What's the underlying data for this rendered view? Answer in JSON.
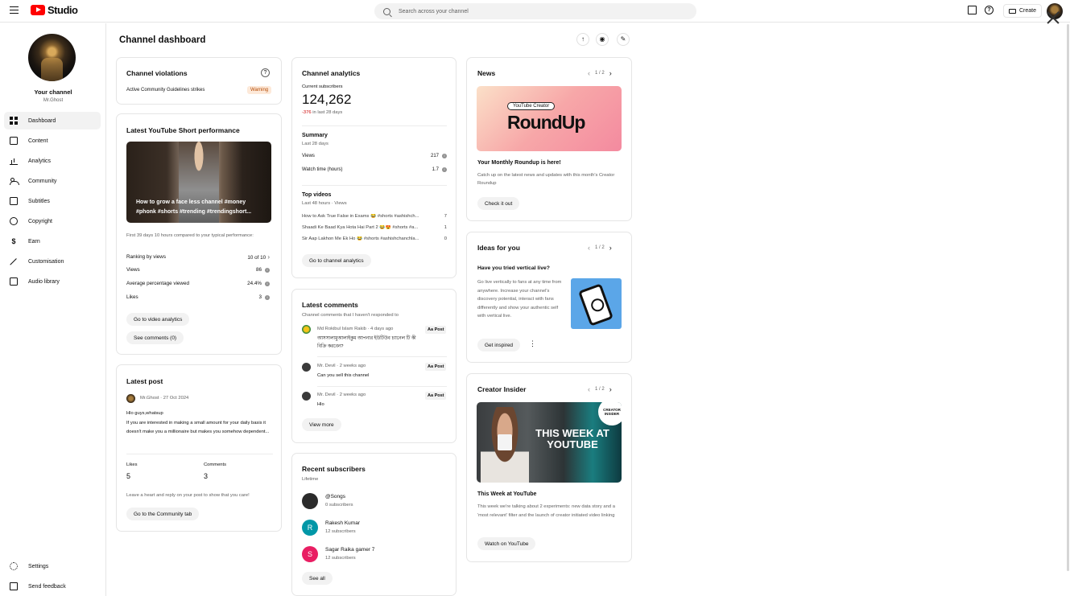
{
  "topbar": {
    "logo_text": "Studio",
    "search_placeholder": "Search across your channel",
    "create_label": "Create"
  },
  "sidebar": {
    "channel_label": "Your channel",
    "channel_name": "Mr.Ghost",
    "items": [
      {
        "label": "Dashboard",
        "icon": "dashboard-icon",
        "active": true
      },
      {
        "label": "Content",
        "icon": "content-icon"
      },
      {
        "label": "Analytics",
        "icon": "analytics-icon"
      },
      {
        "label": "Community",
        "icon": "community-icon"
      },
      {
        "label": "Subtitles",
        "icon": "subtitles-icon"
      },
      {
        "label": "Copyright",
        "icon": "copyright-icon"
      },
      {
        "label": "Earn",
        "icon": "earn-icon"
      },
      {
        "label": "Customisation",
        "icon": "customisation-icon"
      },
      {
        "label": "Audio library",
        "icon": "audio-library-icon"
      }
    ],
    "bottom_items": [
      {
        "label": "Settings",
        "icon": "settings-icon"
      },
      {
        "label": "Send feedback",
        "icon": "feedback-icon"
      }
    ]
  },
  "page": {
    "title": "Channel dashboard"
  },
  "violations": {
    "title": "Channel violations",
    "row_label": "Active Community Guidelines strikes",
    "badge": "Warning"
  },
  "short_perf": {
    "title": "Latest YouTube Short performance",
    "thumb_caption": "How to grow a face less channel #money #phonk #shorts #trending #trendingshort...",
    "period": "First 39 days 10 hours compared to your typical performance:",
    "rows": [
      {
        "label": "Ranking by views",
        "value": "10 of 10"
      },
      {
        "label": "Views",
        "value": "86"
      },
      {
        "label": "Average percentage viewed",
        "value": "24.4%"
      },
      {
        "label": "Likes",
        "value": "3"
      }
    ],
    "btn_analytics": "Go to video analytics",
    "btn_comments": "See comments (0)"
  },
  "latest_post": {
    "title": "Latest post",
    "author": "Mr.Ghost",
    "date": "27 Oct 2024",
    "text_line1": "Hlo guys,whatsup",
    "text_body": "If you are interested in making a small amount for your daily basis it doesn't make you a millionaire but makes you somehow dependent...",
    "likes_label": "Likes",
    "likes_value": "5",
    "comments_label": "Comments",
    "comments_value": "3",
    "hint": "Leave a heart and reply on your post to show that you care!",
    "btn": "Go to the Community tab"
  },
  "analytics": {
    "title": "Channel analytics",
    "subs_label": "Current subscribers",
    "subs_value": "124,262",
    "subs_change": "-376",
    "subs_change_suffix": "in last 28 days",
    "summary_title": "Summary",
    "summary_period": "Last 28 days",
    "views_label": "Views",
    "views_value": "217",
    "watch_label": "Watch time (hours)",
    "watch_value": "1.7",
    "top_title": "Top videos",
    "top_period": "Last 48 hours · Views",
    "top_videos": [
      {
        "title": "How to Ask True False in Exams 😂 #shorts #ashishch...",
        "views": "7"
      },
      {
        "title": "Shaadi Ke Baad Kya Hota Hai Part 2 😂😍 #shorts #a...",
        "views": "1"
      },
      {
        "title": "Sir Aap Lakhon Me Ek Ho 😂 #shorts #ashishchanchla...",
        "views": "0"
      }
    ],
    "btn": "Go to channel analytics"
  },
  "comments": {
    "title": "Latest comments",
    "subtitle": "Channel comments that I haven't responded to",
    "items": [
      {
        "author": "Md Rokibul Islam Rakib",
        "time": "4 days ago",
        "text": "আসসালামুআলাইকুম আপনার ইউটিউব চ্যানেল টি কী বিক্রি করবেন?",
        "action": "Post"
      },
      {
        "author": "Mr. Devil",
        "time": "2 weeks ago",
        "text": "Can you sell this channel",
        "action": "Post"
      },
      {
        "author": "Mr. Devil",
        "time": "2 weeks ago",
        "text": "Hlo",
        "action": "Post"
      }
    ],
    "btn": "View more"
  },
  "subscribers": {
    "title": "Recent subscribers",
    "period": "Lifetime",
    "items": [
      {
        "name": "@Songs",
        "count": "0 subscribers",
        "initial": "",
        "color": "#2b2b2b"
      },
      {
        "name": "Rakesh Kumar",
        "count": "12 subscribers",
        "initial": "R",
        "color": "#0097a7"
      },
      {
        "name": "Sagar Raika gamer 7",
        "count": "12 subscribers",
        "initial": "S",
        "color": "#e91e63"
      }
    ],
    "btn": "See all"
  },
  "news": {
    "title": "News",
    "pager": "1 / 2",
    "img_pill": "YouTube Creator",
    "img_text": "RoundUp",
    "headline": "Your Monthly Roundup is here!",
    "body": "Catch up on the latest news and updates with this month's Creator Roundup",
    "btn": "Check it out"
  },
  "ideas": {
    "title": "Ideas for you",
    "pager": "1 / 2",
    "headline": "Have you tried vertical live?",
    "body": "Go live vertically to fans at any time from anywhere. Increase your channel's discovery potential, interact with fans differently and show your authentic self with vertical live.",
    "btn": "Get inspired"
  },
  "insider": {
    "title": "Creator Insider",
    "pager": "1 / 2",
    "img_text": "THIS WEEK AT YOUTUBE",
    "img_badge": "CREATOR INSIDER",
    "headline": "This Week at YouTube",
    "body": "This week we're talking about 2 experiments: new data story and a 'most relevant' filter and the launch of creator initiated video linking",
    "btn": "Watch on YouTube"
  }
}
